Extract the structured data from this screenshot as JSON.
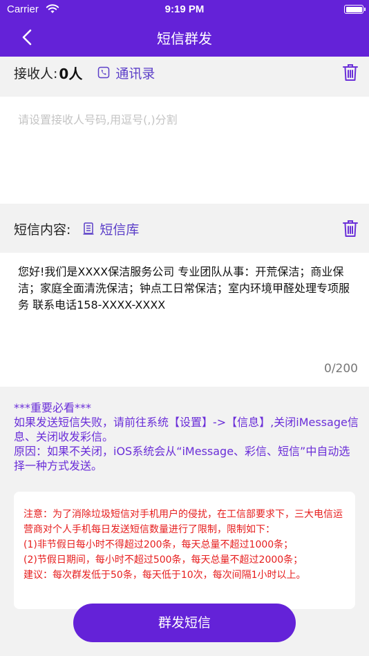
{
  "status_bar": {
    "carrier": "Carrier",
    "time": "9:19 PM"
  },
  "nav": {
    "title": "短信群发",
    "back_icon": "chevron-left-icon"
  },
  "recipients": {
    "label": "接收人:",
    "count": "0人",
    "contacts_link": "通讯录",
    "input_placeholder": "请设置接收人号码,用逗号(,)分割"
  },
  "message": {
    "label": "短信内容:",
    "library_link": "短信库",
    "text": "您好!我们是XXXX保洁服务公司 专业团队从事：开荒保洁；商业保洁；家庭全面清洗保洁；钟点工日常保洁；室内环境甲醛处理专项服务 联系电话158-XXXX-XXXX",
    "counter": "0/200"
  },
  "notice": {
    "title": "***重要必看***",
    "line1": "如果发送短信失败，请前往系统【设置】->【信息】,关闭iMessage信息、关闭收发彩信。",
    "line2": "原因：如果不关闭，iOS系统会从“iMessage、彩信、短信”中自动选择一种方式发送。"
  },
  "warning": {
    "line1": "注意：为了消除垃圾短信对手机用户的侵扰，在工信部要求下，三大电信运营商对个人手机每日发送短信数量进行了限制，限制如下：",
    "line2": "(1)非节假日每小时不得超过200条，每天总量不超过1000条；",
    "line3": "(2)节假日期间，每小时不超过500条，每天总量不超过2000条；",
    "line4": "建议：每次群发低于50条，每天低于10次，每次间隔1小时以上。"
  },
  "send_button": "群发短信",
  "colors": {
    "brand": "#6422d8",
    "link": "#5b3ec8",
    "warning": "#e61d1d"
  }
}
